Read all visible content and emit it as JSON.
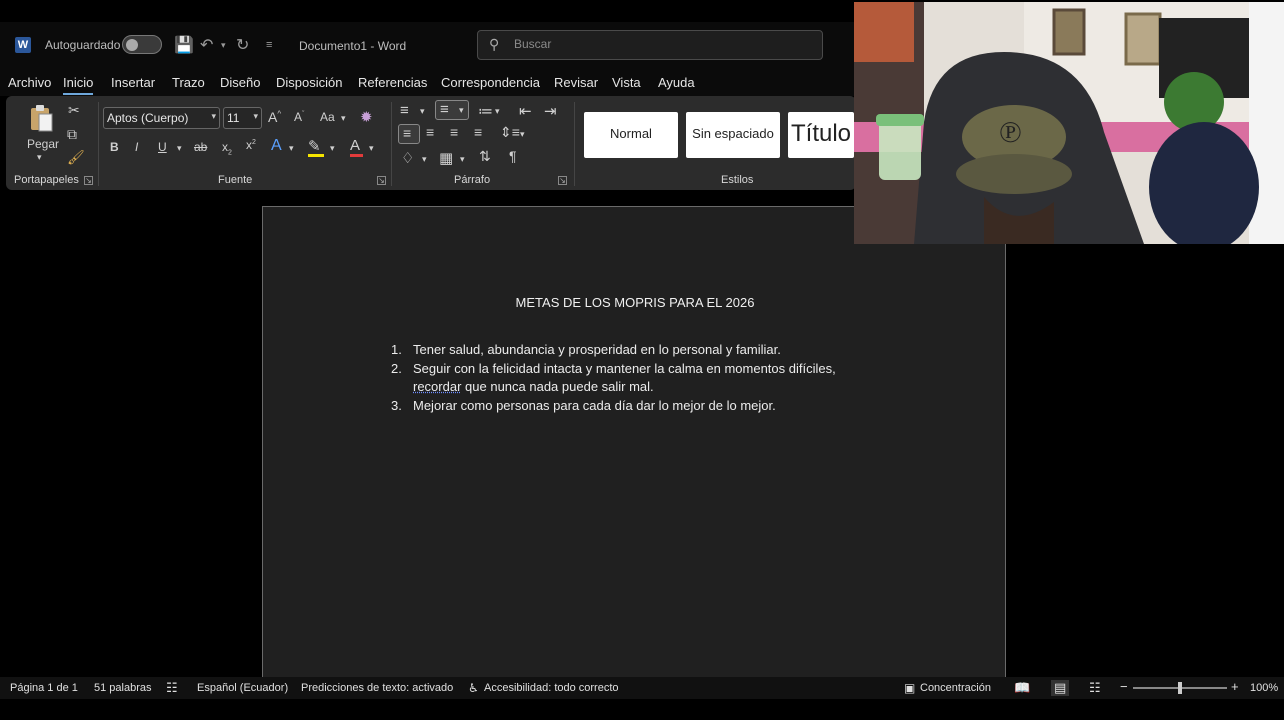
{
  "titlebar": {
    "autosave_label": "Autoguardado",
    "doc_title": "Documento1 - Word",
    "search_placeholder": "Buscar"
  },
  "menu": {
    "tabs": [
      "Archivo",
      "Inicio",
      "Insertar",
      "Trazo",
      "Diseño",
      "Disposición",
      "Referencias",
      "Correspondencia",
      "Revisar",
      "Vista",
      "Ayuda"
    ],
    "active": "Inicio"
  },
  "ribbon": {
    "paste_label": "Pegar",
    "font_name": "Aptos (Cuerpo)",
    "font_size": "11",
    "change_case": "Aa",
    "groups": {
      "clipboard": "Portapapeles",
      "font": "Fuente",
      "paragraph": "Párrafo",
      "styles": "Estilos"
    },
    "styles": [
      "Normal",
      "Sin espaciado",
      "Título"
    ]
  },
  "document": {
    "heading": "METAS DE LOS MOPRIS PARA EL 2026",
    "goals": [
      {
        "num": "1.",
        "text": "Tener salud, abundancia y prosperidad en lo personal y familiar."
      },
      {
        "num": "2.",
        "text_a": "Seguir con la felicidad intacta y mantener la calma en momentos difíciles,",
        "text_spell": "recordar",
        "text_b": " que nunca nada puede salir mal."
      },
      {
        "num": "3.",
        "text": "Mejorar como personas para cada día dar lo mejor de lo mejor."
      }
    ]
  },
  "status": {
    "page": "Página 1 de 1",
    "words": "51 palabras",
    "language": "Español (Ecuador)",
    "predictions": "Predicciones de texto: activado",
    "accessibility": "Accesibilidad: todo correcto",
    "focus": "Concentración",
    "zoom": "100%"
  },
  "colors": {
    "accent": "#6fa8dc",
    "word_brand": "#2b579a"
  }
}
